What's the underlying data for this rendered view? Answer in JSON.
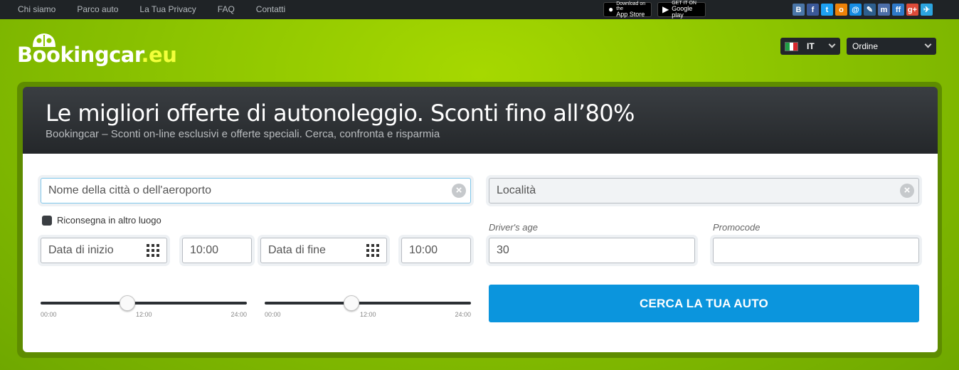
{
  "topnav": [
    "Chi siamo",
    "Parco auto",
    "La Tua Privacy",
    "FAQ",
    "Contatti"
  ],
  "stores": {
    "appstore_small": "Download on the",
    "appstore_big": "App Store",
    "googleplay_small": "GET IT ON",
    "googleplay_big": "Google play"
  },
  "socials": [
    {
      "icon": "vk-icon",
      "glyph": "B",
      "color": "#4a76a8"
    },
    {
      "icon": "facebook-icon",
      "glyph": "f",
      "color": "#3b5998"
    },
    {
      "icon": "twitter-icon",
      "glyph": "t",
      "color": "#1da1f2"
    },
    {
      "icon": "odnoklassniki-icon",
      "glyph": "o",
      "color": "#ee8208"
    },
    {
      "icon": "mailru-icon",
      "glyph": "@",
      "color": "#168de2"
    },
    {
      "icon": "livejournal-icon",
      "glyph": "✎",
      "color": "#2d5f8e"
    },
    {
      "icon": "myspace-icon",
      "glyph": "m",
      "color": "#4c6ea8"
    },
    {
      "icon": "friendfeed-icon",
      "glyph": "ff",
      "color": "#2e79c8"
    },
    {
      "icon": "googleplus-icon",
      "glyph": "g+",
      "color": "#dd4b39"
    },
    {
      "icon": "telegram-icon",
      "glyph": "✈",
      "color": "#2ca5e0"
    }
  ],
  "logo": {
    "name": "Bookingcar",
    "tld": ".eu"
  },
  "language": {
    "code": "IT"
  },
  "order": {
    "label": "Ordine"
  },
  "hero": {
    "title": "Le migliori offerte di autonoleggio. Sconti fino all’80%",
    "subtitle": "Bookingcar – Sconti on-line esclusivi e offerte speciali. Cerca, confronta e risparmia"
  },
  "form": {
    "pickup_placeholder": "Nome della città o dell'aeroporto",
    "location_placeholder": "Località",
    "return_other": "Riconsegna in altro luogo",
    "start_date_placeholder": "Data di inizio",
    "start_time": "10:00",
    "end_date_placeholder": "Data di fine",
    "end_time": "10:00",
    "driver_age_label": "Driver's age",
    "driver_age": "30",
    "promocode_label": "Promocode",
    "promocode": "",
    "search_button": "CERCA LA TUA AUTO"
  },
  "sliders": [
    {
      "level": 0.42,
      "ticks": [
        "00:00",
        "12:00",
        "24:00"
      ]
    },
    {
      "level": 0.42,
      "ticks": [
        "00:00",
        "12:00",
        "24:00"
      ]
    }
  ]
}
